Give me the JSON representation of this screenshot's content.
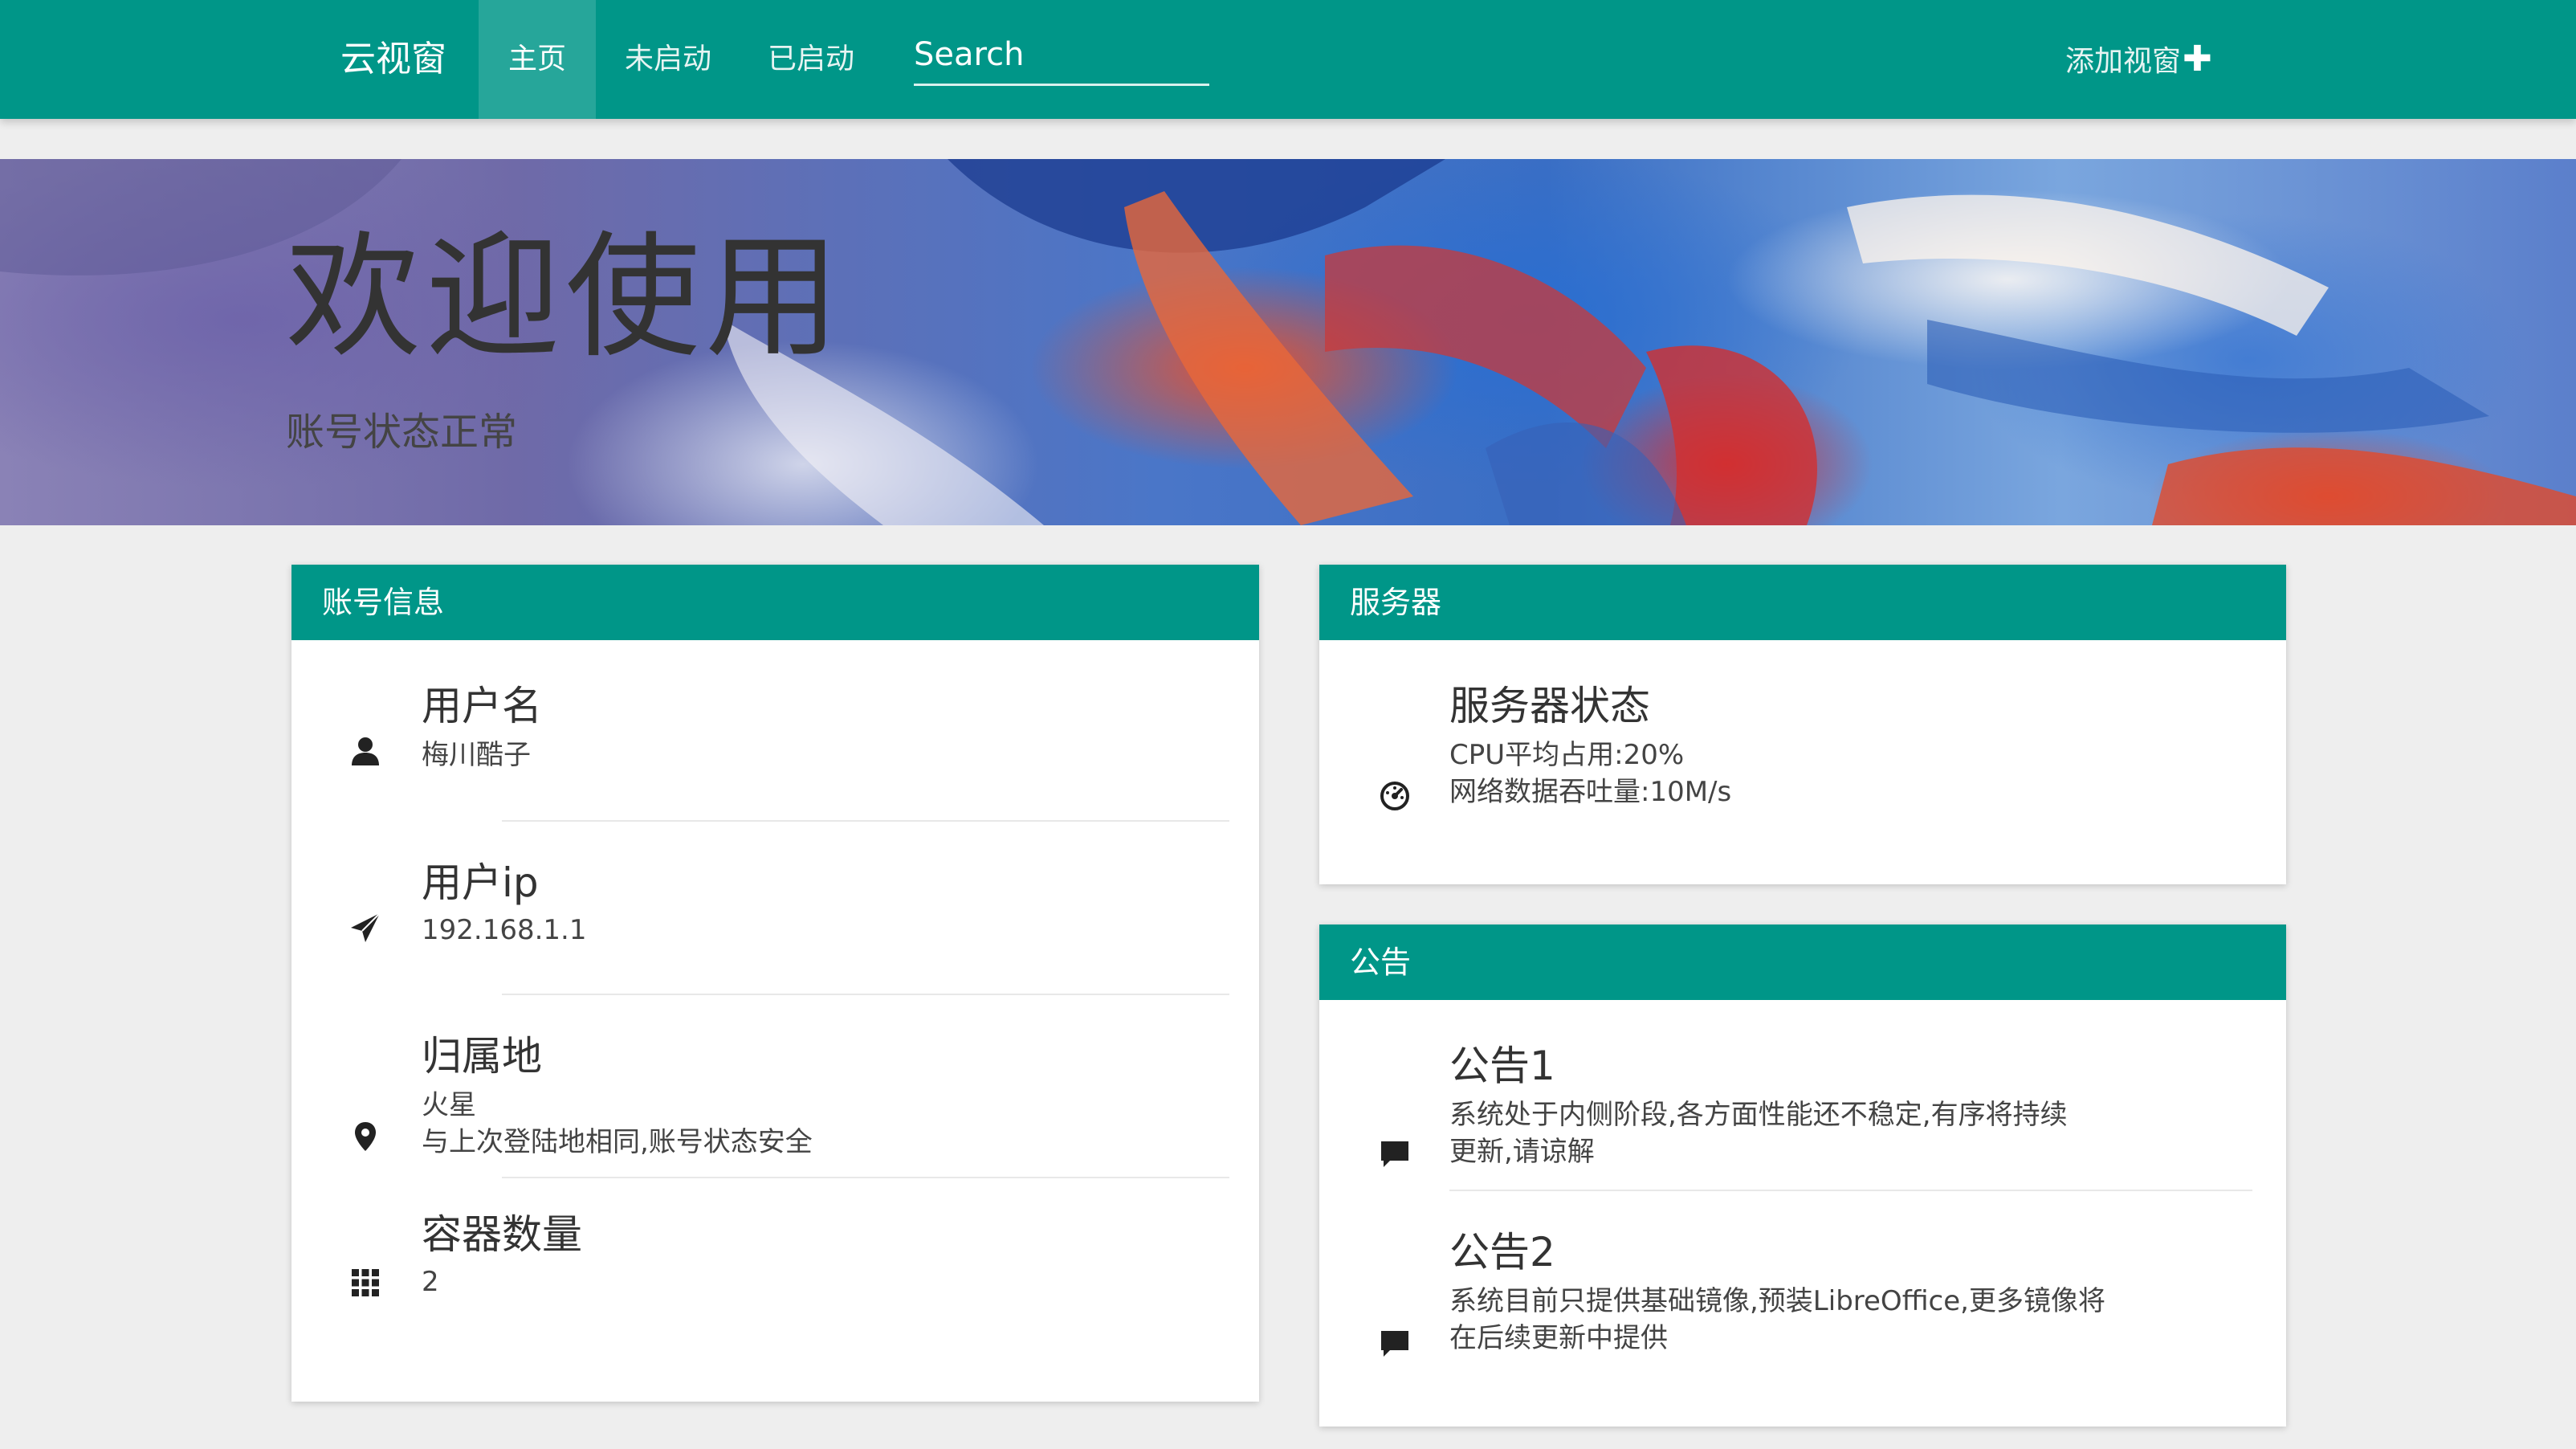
{
  "nav": {
    "brand": "云视窗",
    "items": [
      {
        "label": "主页",
        "active": true
      },
      {
        "label": "未启动",
        "active": false
      },
      {
        "label": "已启动",
        "active": false
      }
    ],
    "search_placeholder": "Search",
    "add_window": "添加视窗",
    "add_icon": "plus-icon"
  },
  "banner": {
    "title": "欢迎使用",
    "subtitle": "账号状态正常"
  },
  "account": {
    "header": "账号信息",
    "items": [
      {
        "title": "用户名",
        "lines": [
          "梅川酷子"
        ],
        "icon": "user-icon"
      },
      {
        "title": "用户ip",
        "lines": [
          "192.168.1.1"
        ],
        "icon": "send-icon"
      },
      {
        "title": "归属地",
        "lines": [
          "火星",
          "与上次登陆地相同,账号状态安全"
        ],
        "icon": "location-pin-icon"
      },
      {
        "title": "容器数量",
        "lines": [
          "2"
        ],
        "icon": "grid-icon"
      }
    ]
  },
  "server": {
    "header": "服务器",
    "items": [
      {
        "title": "服务器状态",
        "lines": [
          "CPU平均占用:20%",
          "网络数据吞吐量:10M/s"
        ],
        "icon": "dashboard-icon"
      }
    ]
  },
  "notice": {
    "header": "公告",
    "items": [
      {
        "title": "公告1",
        "lines": [
          "系统处于内侧阶段,各方面性能还不稳定,有序将持续",
          "更新,请谅解"
        ],
        "icon": "comment-icon"
      },
      {
        "title": "公告2",
        "lines": [
          "系统目前只提供基础镜像,预装LibreOffice,更多镜像将",
          "在后续更新中提供"
        ],
        "icon": "comment-icon"
      }
    ]
  },
  "colors": {
    "primary": "#009688",
    "active_nav": "#26a69a",
    "background": "#eeeeee"
  }
}
